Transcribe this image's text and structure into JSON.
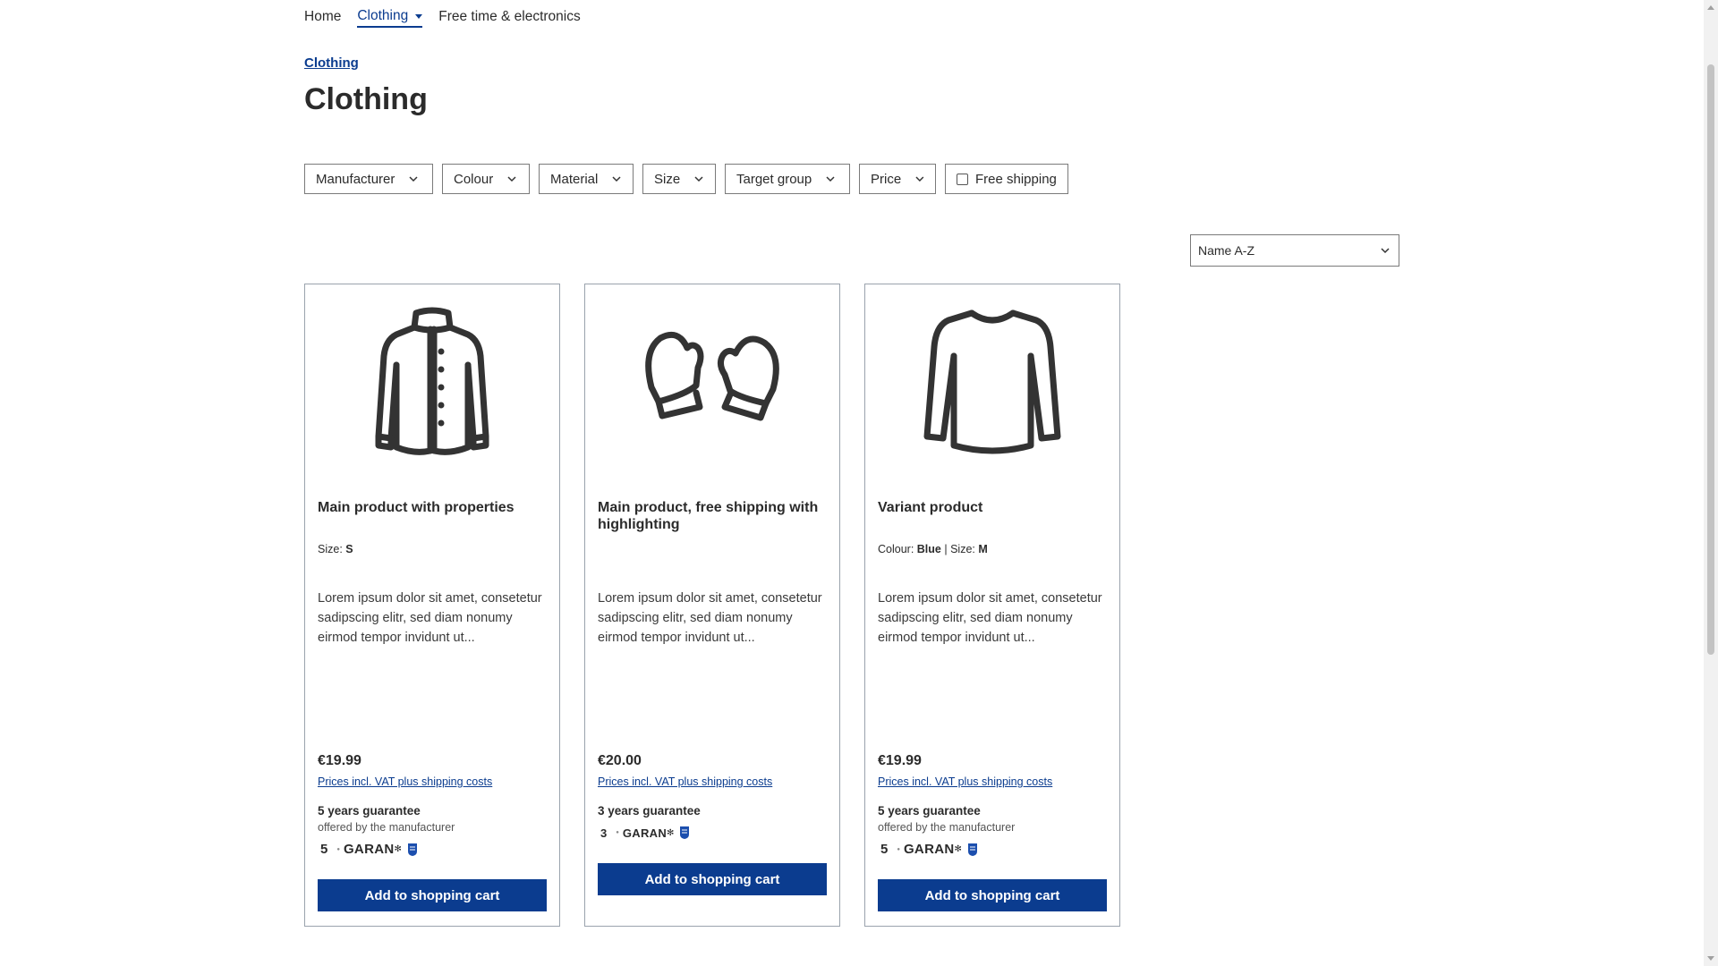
{
  "nav": {
    "items": [
      {
        "label": "Home",
        "active": false
      },
      {
        "label": "Clothing",
        "active": true
      },
      {
        "label": "Free time & electronics",
        "active": false
      }
    ]
  },
  "breadcrumb": "Clothing",
  "title": "Clothing",
  "filters": {
    "manufacturer": "Manufacturer",
    "colour": "Colour",
    "material": "Material",
    "size": "Size",
    "target_group": "Target group",
    "price": "Price",
    "free_shipping": "Free shipping"
  },
  "sort": {
    "selected": "Name A-Z"
  },
  "products": [
    {
      "icon": "jacket-icon",
      "name": "Main product with properties",
      "props": {
        "size_label": "Size:",
        "size_value": "S"
      },
      "description": "Lorem ipsum dolor sit amet, consetetur sadipscing elitr, sed diam nonumy eirmod tempor invidunt ut...",
      "price": "€19.99",
      "vat": "Prices incl. VAT plus shipping costs",
      "guarantee_title": "5 years guarantee",
      "guarantee_sub": "offered by the manufacturer",
      "badge_years": "5",
      "badge_text": "GARAN",
      "cart_label": "Add to shopping cart"
    },
    {
      "icon": "mittens-icon",
      "name": "Main product, free shipping with highlighting",
      "description": "Lorem ipsum dolor sit amet, consetetur sadipscing elitr, sed diam nonumy eirmod tempor invidunt ut...",
      "price": "€20.00",
      "vat": "Prices incl. VAT plus shipping costs",
      "guarantee_title": "3 years guarantee",
      "badge_years": "3",
      "badge_text": "GARAN",
      "cart_label": "Add to shopping cart"
    },
    {
      "icon": "sweater-icon",
      "name": "Variant product",
      "props": {
        "colour_label": "Colour:",
        "colour_value": "Blue",
        "separator": "|",
        "size_label": "Size:",
        "size_value": "M"
      },
      "description": "Lorem ipsum dolor sit amet, consetetur sadipscing elitr, sed diam nonumy eirmod tempor invidunt ut...",
      "price": "€19.99",
      "vat": "Prices incl. VAT plus shipping costs",
      "guarantee_title": "5 years guarantee",
      "guarantee_sub": "offered by the manufacturer",
      "badge_years": "5",
      "badge_text": "GARAN",
      "cart_label": "Add to shopping cart"
    }
  ],
  "colors": {
    "accent": "#0b3c8f",
    "text": "#2b2b2b",
    "border": "#9aa3ad"
  }
}
